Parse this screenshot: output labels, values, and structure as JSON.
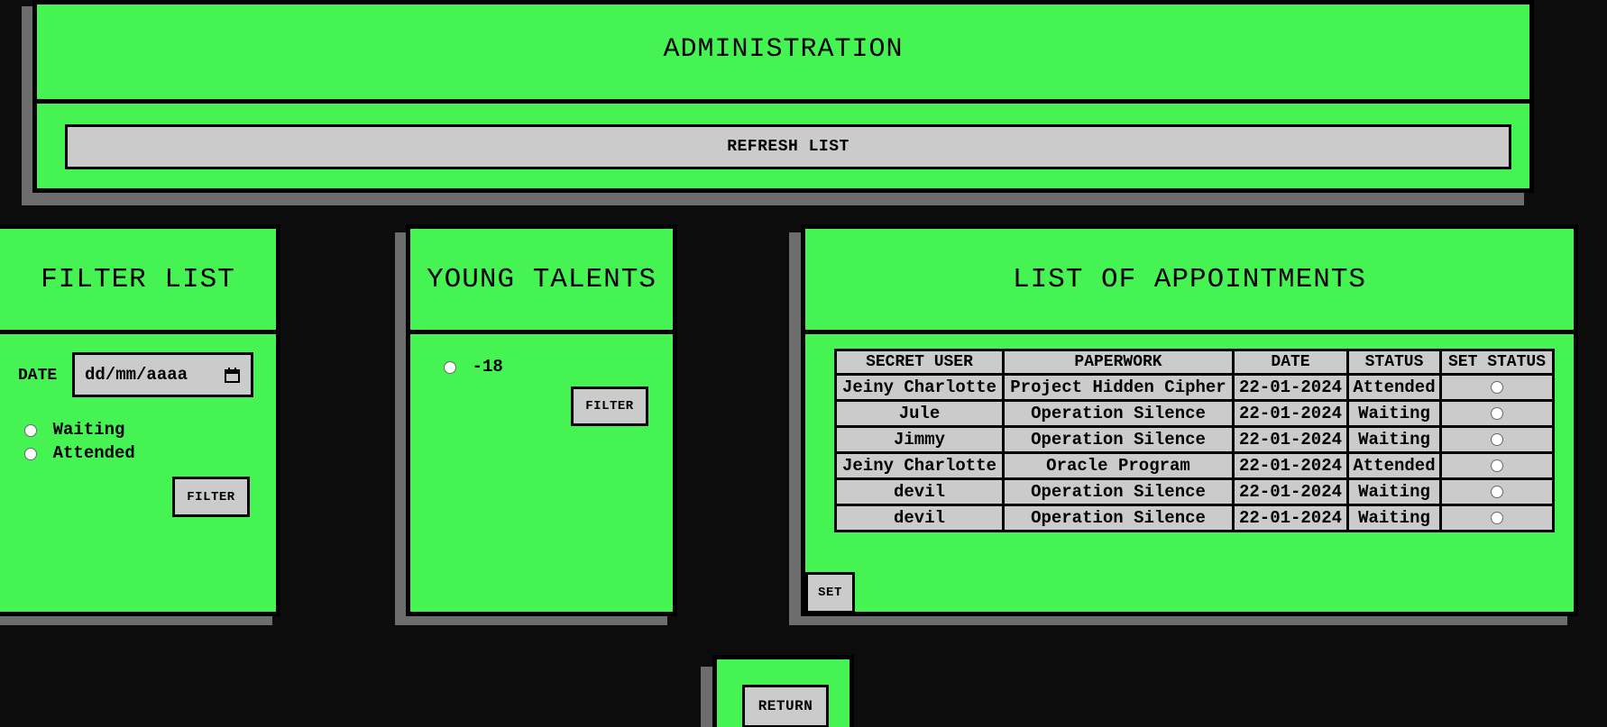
{
  "admin": {
    "title": "ADMINISTRATION",
    "refresh_label": "REFRESH LIST"
  },
  "filter": {
    "title": "FILTER LIST",
    "date_label": "DATE",
    "date_placeholder": "dd/mm/aaaa",
    "options": [
      "Waiting",
      "Attended"
    ],
    "button_label": "FILTER"
  },
  "talents": {
    "title": "YOUNG TALENTS",
    "option": "-18",
    "button_label": "FILTER"
  },
  "appointments": {
    "title": "LIST OF APPOINTMENTS",
    "headers": [
      "SECRET USER",
      "PAPERWORK",
      "DATE",
      "STATUS",
      "SET STATUS"
    ],
    "rows": [
      [
        "Jeiny Charlotte",
        "Project Hidden Cipher",
        "22-01-2024",
        "Attended"
      ],
      [
        "Jule",
        "Operation Silence",
        "22-01-2024",
        "Waiting"
      ],
      [
        "Jimmy",
        "Operation Silence",
        "22-01-2024",
        "Waiting"
      ],
      [
        "Jeiny Charlotte",
        "Oracle Program",
        "22-01-2024",
        "Attended"
      ],
      [
        "devil",
        "Operation Silence",
        "22-01-2024",
        "Waiting"
      ],
      [
        "devil",
        "Operation Silence",
        "22-01-2024",
        "Waiting"
      ]
    ],
    "set_label": "SET"
  },
  "return_label": "RETURN",
  "colors": {
    "background": "#0c0c0c",
    "panel": "#45f352",
    "button": "#cbcbcb",
    "shadow": "#6d6d6d"
  }
}
